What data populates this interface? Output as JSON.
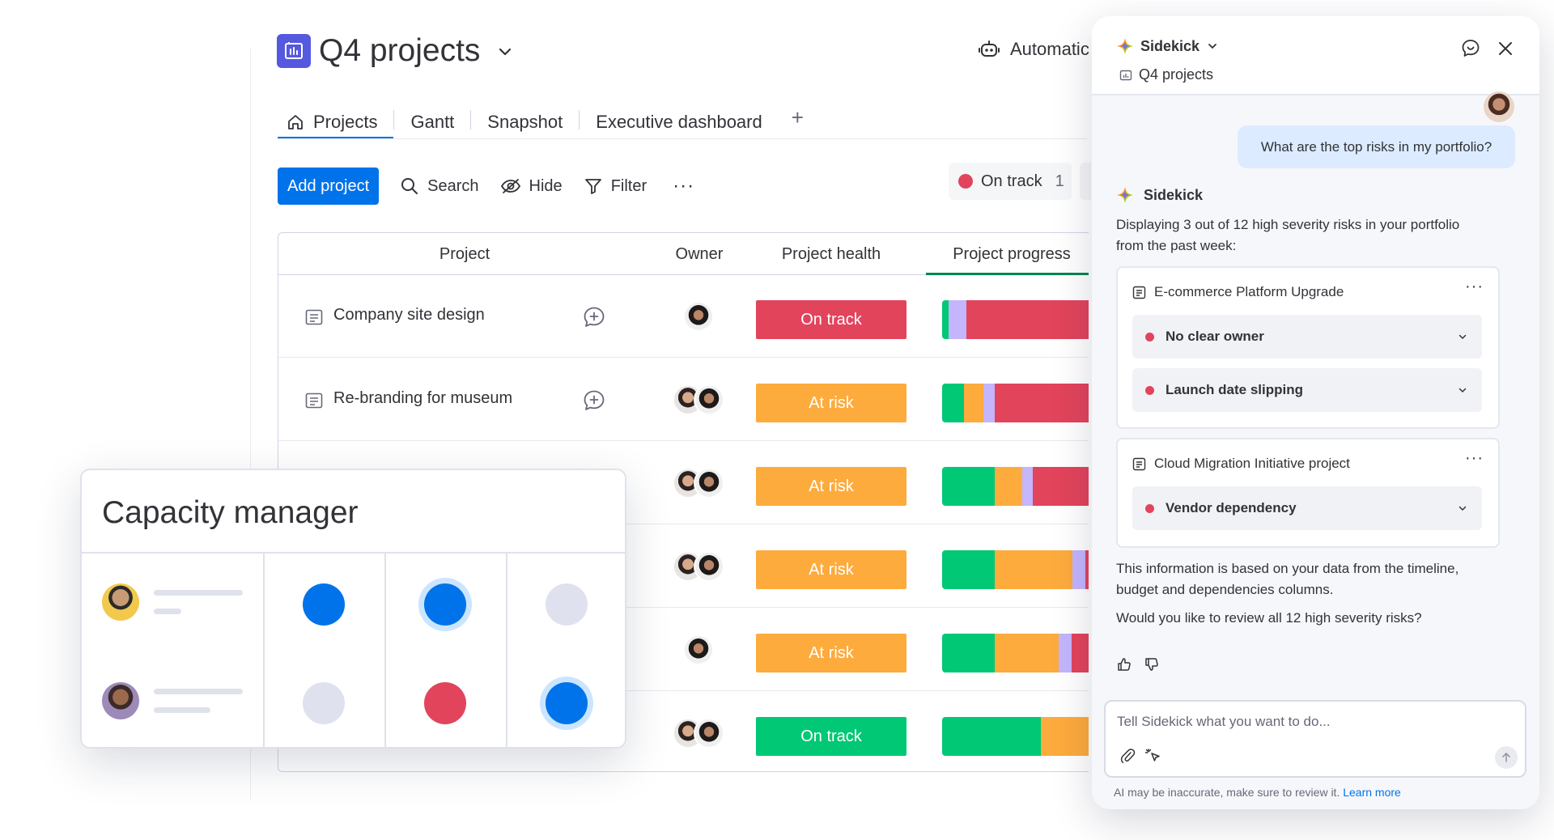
{
  "board": {
    "title": "Q4 projects",
    "automations_label": "Automatic",
    "tabs": [
      {
        "label": "Projects",
        "active": true
      },
      {
        "label": "Gantt"
      },
      {
        "label": "Snapshot"
      },
      {
        "label": "Executive dashboard"
      }
    ],
    "add_tab_label": "+",
    "toolbar": {
      "add_project": "Add project",
      "search": "Search",
      "hide": "Hide",
      "filter": "Filter",
      "more": "···"
    },
    "status_chip": {
      "label": "On track",
      "count": "1"
    },
    "columns": {
      "project": "Project",
      "owner": "Owner",
      "health": "Project health",
      "progress": "Project progress"
    },
    "rows": [
      {
        "name": "Company site design",
        "health": "On track"
      },
      {
        "name": "Re-branding for museum",
        "health": "At risk"
      },
      {
        "name": "",
        "health": "At risk"
      },
      {
        "name": "",
        "health": "At risk"
      },
      {
        "name": "",
        "health": "At risk"
      },
      {
        "name": "",
        "health": "On track"
      }
    ]
  },
  "colors": {
    "primary": "#0073ea",
    "status_red": "#e2445c",
    "status_orange": "#fdab3d",
    "status_green": "#00c875",
    "purple": "#a25ddc",
    "lavender": "#c4b5fd",
    "board_icon": "#5559df"
  },
  "capacity_manager": {
    "title": "Capacity manager"
  },
  "sidekick": {
    "title": "Sidekick",
    "board_name": "Q4 projects",
    "user_message": "What are the top risks in my portfolio?",
    "bot_name": "Sidekick",
    "intro": "Displaying 3 out of 12 high severity risks in your portfolio from the past week:",
    "risk_groups": [
      {
        "project": "E-commerce Platform Upgrade",
        "risks": [
          "No clear owner",
          "Launch date slipping"
        ]
      },
      {
        "project": "Cloud Migration Initiative project",
        "risks": [
          "Vendor dependency"
        ]
      }
    ],
    "info": "This information is based on your data from the timeline, budget and dependencies columns.",
    "question": "Would you like to review all 12 high severity risks?",
    "input_placeholder": "Tell Sidekick what you want to do...",
    "disclaimer": "AI may be inaccurate, make sure to review it.",
    "learn_more": "Learn more"
  },
  "icons": [
    "board-icon",
    "chevron-down-icon",
    "robot-icon",
    "home-icon",
    "search-icon",
    "eye-off-icon",
    "filter-icon",
    "item-icon",
    "add-update-icon",
    "sparkle-icon",
    "chat-icon",
    "close-icon",
    "thumbs-up-icon",
    "thumbs-down-icon",
    "paperclip-icon",
    "pointer-icon",
    "arrow-up-icon"
  ]
}
